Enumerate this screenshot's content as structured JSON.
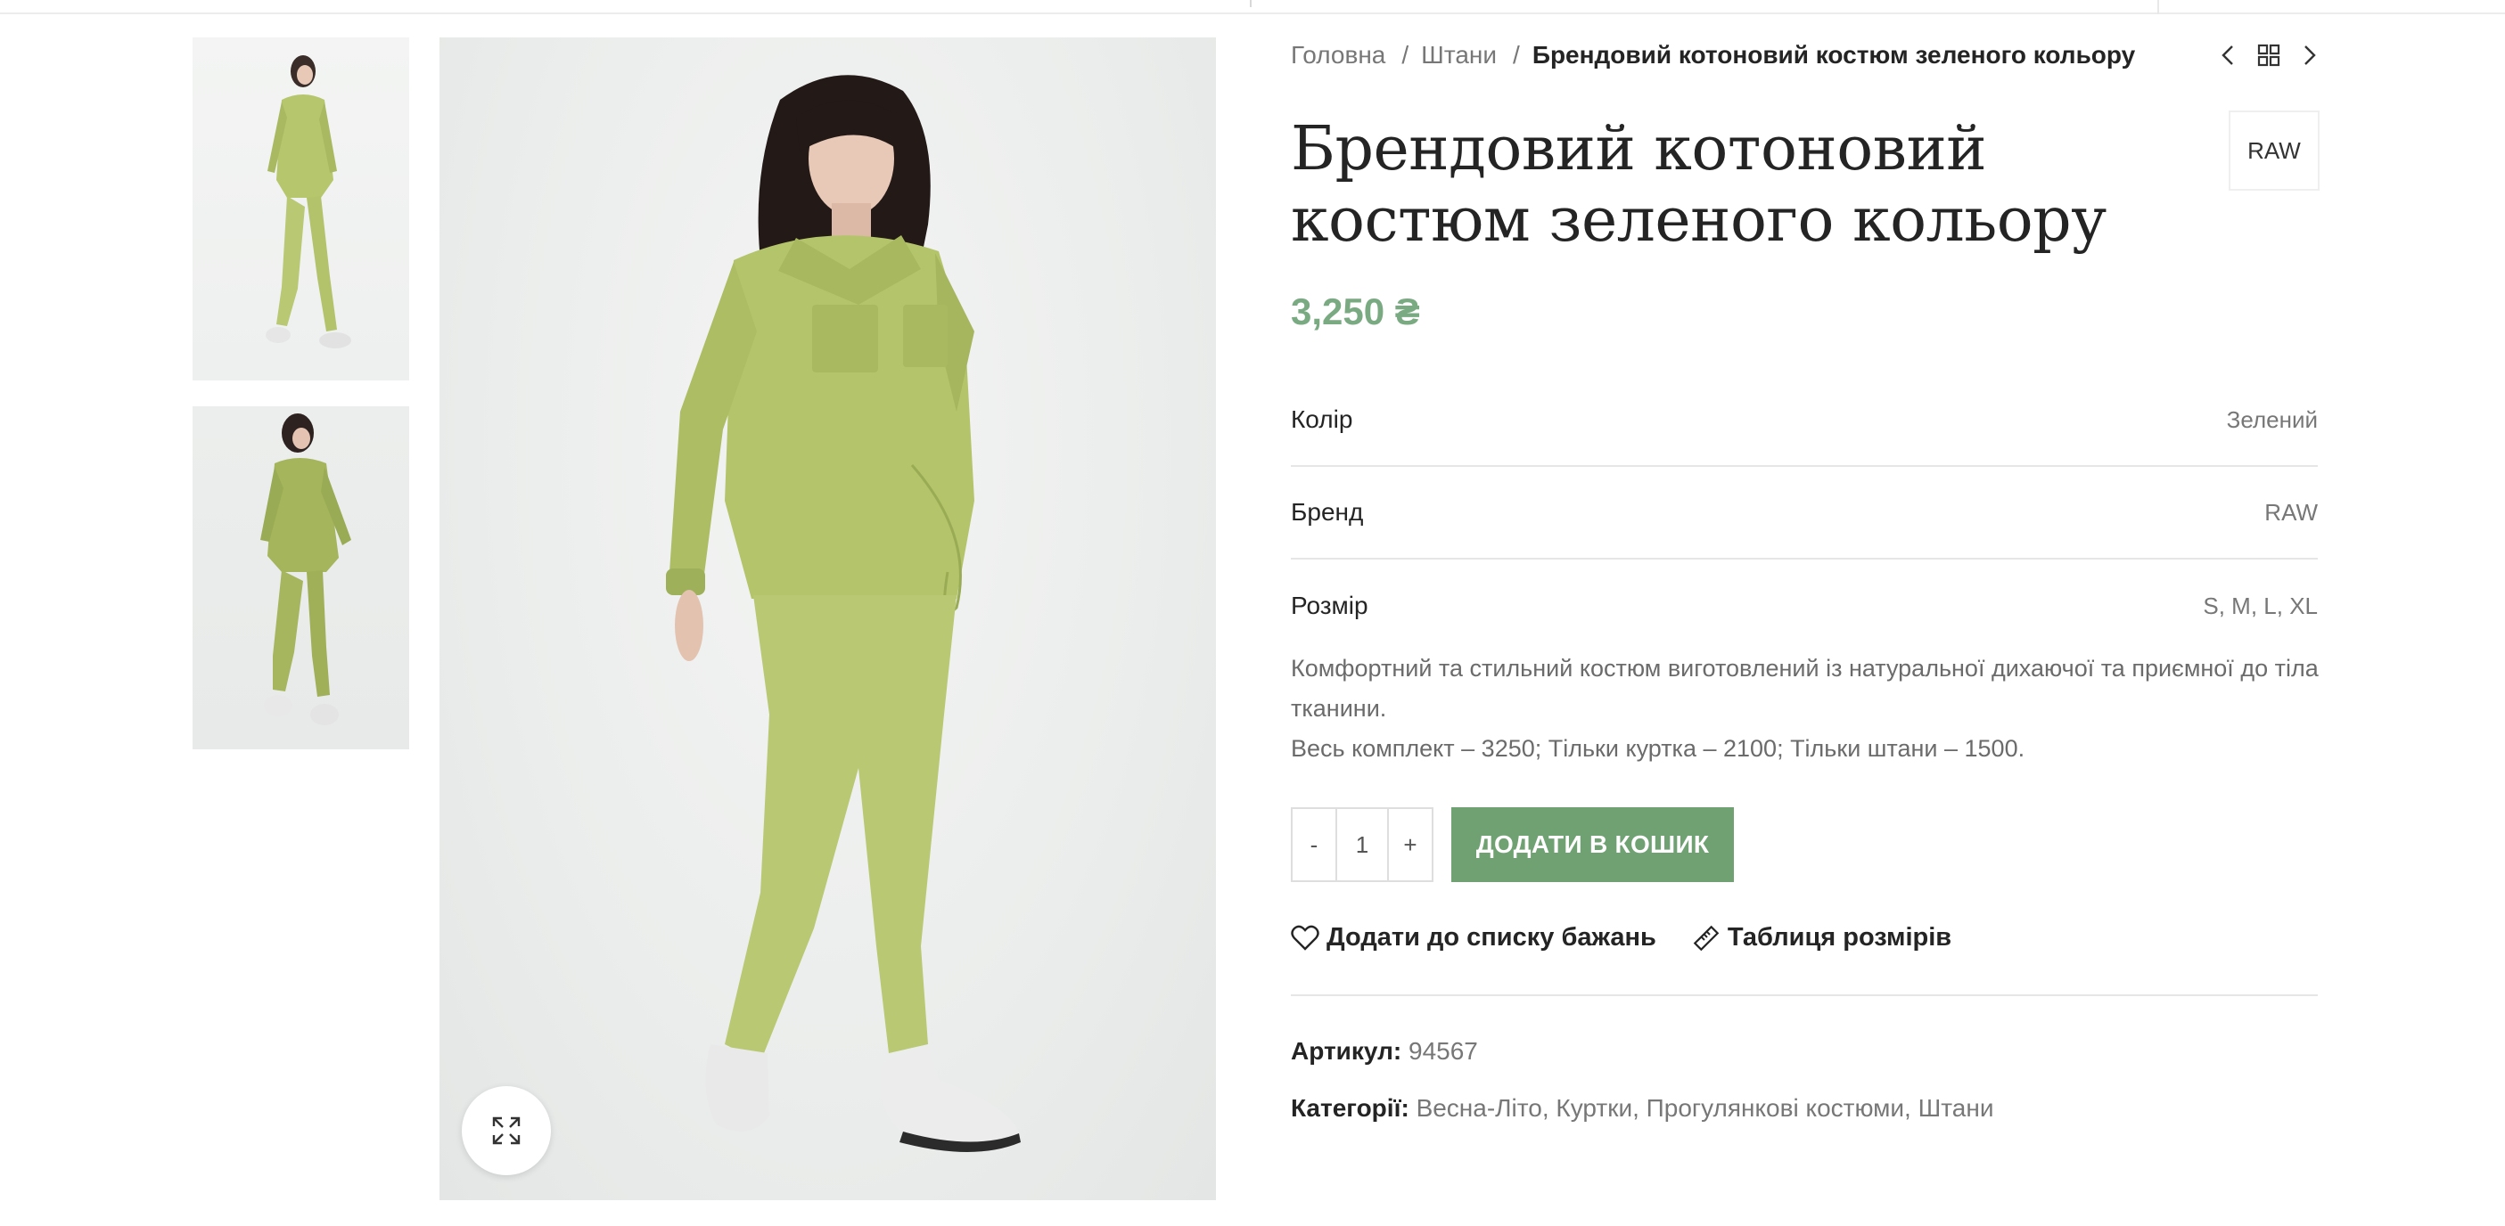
{
  "breadcrumb": {
    "home": "Головна",
    "category": "Штани",
    "current": "Брендовий котоновий костюм зеленого кольору"
  },
  "product": {
    "title": "Брендовий котоновий костюм зеленого кольору",
    "brand_badge": "RAW",
    "price": "3,250 ₴",
    "price_color": "#7aaa82",
    "attributes": [
      {
        "label": "Колір",
        "value": "Зелений"
      },
      {
        "label": "Бренд",
        "value": "RAW"
      },
      {
        "label": "Розмір",
        "value": "S, M, L, XL"
      }
    ],
    "description_line1": "Комфортний та стильний костюм виготовлений із натуральної дихаючої та приємної до тіла тканини.",
    "description_line2": "Весь комплект – 3250; Тільки куртка – 2100; Тільки штани – 1500.",
    "quantity": {
      "minus": "-",
      "value": "1",
      "plus": "+"
    },
    "add_to_cart": "ДОДАТИ В КОШИК",
    "add_to_cart_color": "#6fa173",
    "wishlist": "Додати до списку бажань",
    "size_chart": "Таблиця розмірів",
    "sku_label": "Артикул:",
    "sku_value": "94567",
    "categories_label": "Категорії:",
    "categories": [
      "Весна-Літо",
      "Куртки",
      "Прогулянкові костюми",
      "Штани"
    ]
  },
  "icons": {
    "prev": "chevron-left-icon",
    "grid": "grid-icon",
    "next": "chevron-right-icon",
    "zoom": "expand-icon",
    "wishlist": "heart-icon",
    "size_chart": "ruler-icon"
  },
  "colors": {
    "garment": "#b4c46a",
    "accent": "#6fa173"
  }
}
